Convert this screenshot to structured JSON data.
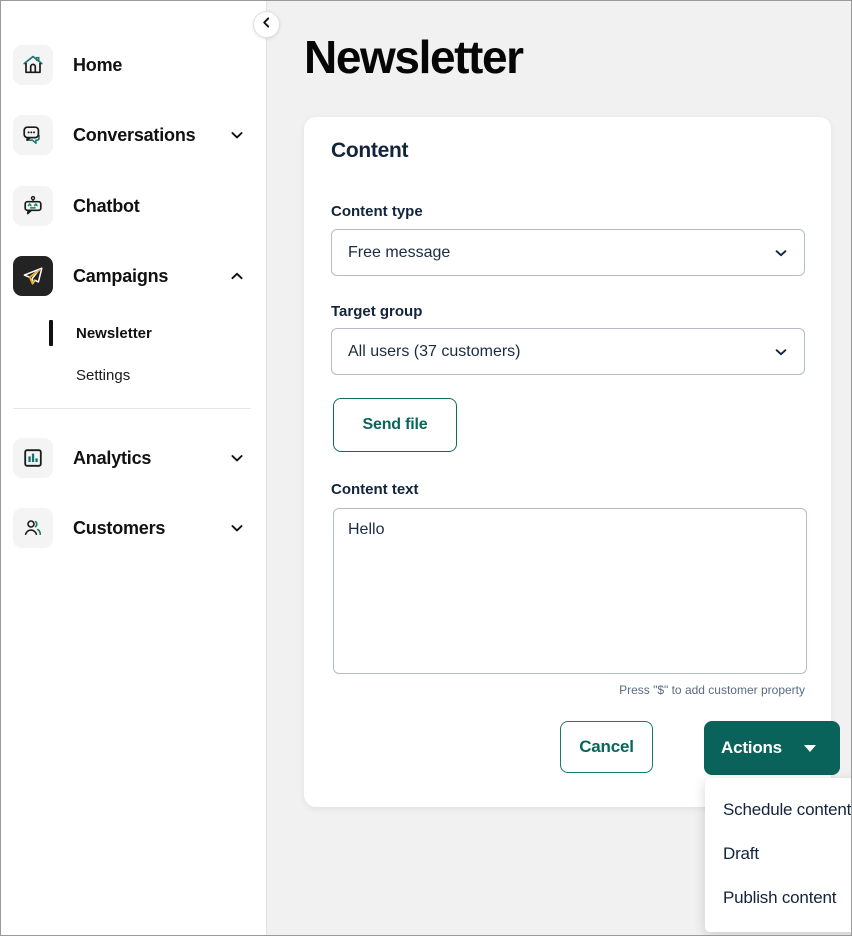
{
  "sidebar": {
    "collapse_icon": "chevron-left-icon",
    "items": [
      {
        "label": "Home",
        "icon": "home-icon",
        "chevron": null,
        "active_tile": false
      },
      {
        "label": "Conversations",
        "icon": "chat-bubbles-icon",
        "chevron": "chevron-down-icon",
        "active_tile": false
      },
      {
        "label": "Chatbot",
        "icon": "robot-icon",
        "chevron": null,
        "active_tile": false
      },
      {
        "label": "Campaigns",
        "icon": "paper-plane-icon",
        "chevron": "chevron-up-icon",
        "active_tile": true
      }
    ],
    "sub_items": [
      {
        "label": "Newsletter",
        "active": true
      },
      {
        "label": "Settings",
        "active": false
      }
    ],
    "lower_items": [
      {
        "label": "Analytics",
        "icon": "bar-chart-icon",
        "chevron": "chevron-down-icon"
      },
      {
        "label": "Customers",
        "icon": "people-icon",
        "chevron": "chevron-down-icon"
      }
    ]
  },
  "main": {
    "page_title": "Newsletter",
    "card": {
      "title": "Content",
      "content_type": {
        "label": "Content type",
        "value": "Free message",
        "chevron": "chevron-down-icon"
      },
      "target_group": {
        "label": "Target group",
        "value": "All users (37 customers)",
        "chevron": "chevron-down-icon"
      },
      "send_file_label": "Send file",
      "content_text": {
        "label": "Content text",
        "value": "Hello",
        "placeholder": "",
        "hint": "Press \"$\" to add customer property"
      },
      "cancel_label": "Cancel",
      "actions_label": "Actions",
      "actions_menu": [
        "Schedule content",
        "Draft",
        "Publish content"
      ]
    }
  },
  "colors": {
    "accent_teal": "#0a635a",
    "accent_teal_border": "#18796c",
    "dark_tile": "#232323",
    "plane_yellow": "#f0a81e",
    "page_bg": "#f1f1f1",
    "text_dark": "#12243c",
    "field_border": "#b3bcc8"
  }
}
